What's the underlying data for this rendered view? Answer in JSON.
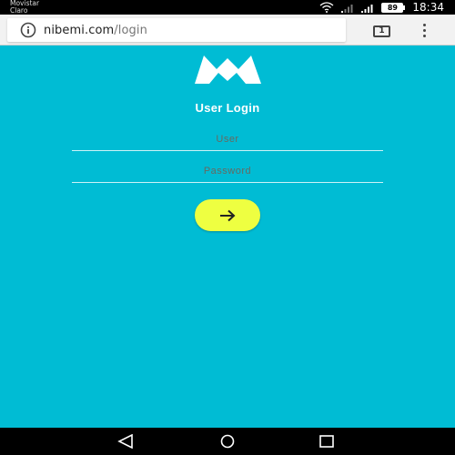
{
  "status_bar": {
    "carrier_line1": "Movistar",
    "carrier_line2": "Claro",
    "battery_level": "89",
    "time": "18:34",
    "icons": [
      "wifi-icon",
      "signal-weak-icon",
      "signal-strong-icon",
      "battery-icon"
    ]
  },
  "browser": {
    "url_domain": "nibemi.com",
    "url_path": "/login",
    "tab_count": "1",
    "icons": [
      "info-icon",
      "tabs-icon",
      "overflow-menu-icon"
    ]
  },
  "login": {
    "title": "User Login",
    "user_placeholder": "User",
    "password_placeholder": "Password",
    "submit_icon": "arrow-right-icon"
  },
  "nav_bar": {
    "icons": [
      "back-icon",
      "home-icon",
      "recents-icon"
    ]
  },
  "colors": {
    "background": "#00bcd4",
    "button": "#eeff41",
    "status_bar": "#000000",
    "browser_bar": "#f2f2f2"
  }
}
